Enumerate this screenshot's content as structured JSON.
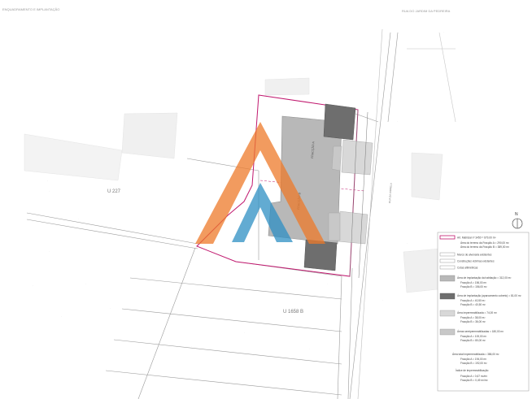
{
  "header": {
    "left_text": "ENQUADRAMENTO E IMPLANTAÇÃO",
    "right_text": "RUA DO JARDIM DA PEDREIRA"
  },
  "map": {
    "parcel_labels": {
      "u227": "U 227",
      "u1658b": "U 1658 B"
    },
    "street_label": "RUA DA CIDRELA",
    "building_a_label": "FRACÇÃO A",
    "building_b_label": "FRACÇÃO B",
    "north_label": "N"
  },
  "legend": {
    "area_label": "Art. Matricial nº 3450 = 679,00 m²",
    "area_sub_a": "Área do terreno da Fracção A = 290,00 m²",
    "area_sub_b": "Área do terreno da Fracção B = 389,00 m²",
    "items": [
      {
        "label": "Muros de alvenaria existentes",
        "swatch": "#ffffff"
      },
      {
        "label": "Construções vizinhas existentes",
        "swatch": "#ffffff"
      },
      {
        "label": "Cotas altimétricas",
        "swatch": "#ffffff"
      }
    ],
    "impl_label": "Área de implantação da habitação = 312,00 m²",
    "impl_a": "Fracção A = 156,00 m²",
    "impl_b": "Fracção B = 156,00 m²",
    "annex_label": "Área de implantação (aparcamento coberto) = 81,00 m²",
    "annex_a": "Fracção A = 40,50 m²",
    "annex_b": "Fracção B = 40,50 m²",
    "imperm_label": "Área impermeabilizada = 74,00 m²",
    "imperm_a": "Fracção A = 38,00 m²",
    "imperm_b": "Fracção B = 36,00 m²",
    "semi_label": "Áreas semipermeabilizadas = 180,00 m²",
    "semi_a": "Fracção A = 100,00 m²",
    "semi_b": "Fracção B = 80,00 m²",
    "total_label": "Área total impermeabilizada = 386,00 m²",
    "total_a": "Fracção A = 194,00 m²",
    "total_b": "Fracção B = 192,00 m²",
    "index_label": "Índice de impermeabilização",
    "index_a": "Fracção A = 0,67 m²/m²",
    "index_b": "Fracção B = 0,49 m²/m²"
  },
  "colors": {
    "line": "#9a9a9a",
    "parcel": "#c0186e",
    "building": "#b8b8b8",
    "annex": "#6e6e6e",
    "semi": "#d8d8d8",
    "watermark_orange": "#ee7a2a",
    "watermark_blue": "#2e8fc4"
  }
}
